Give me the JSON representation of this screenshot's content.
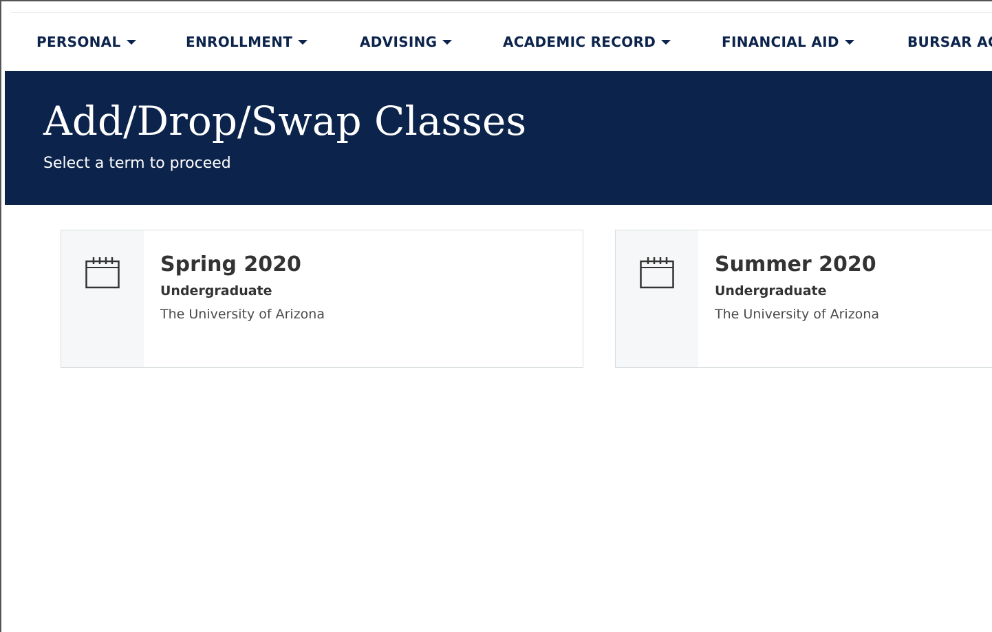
{
  "nav": {
    "items": [
      {
        "label": "PERSONAL",
        "icon": "caret-down-icon"
      },
      {
        "label": "ENROLLMENT",
        "icon": "caret-down-icon"
      },
      {
        "label": "ADVISING",
        "icon": "caret-down-icon"
      },
      {
        "label": "ACADEMIC RECORD",
        "icon": "caret-down-icon"
      },
      {
        "label": "FINANCIAL AID",
        "icon": "caret-down-icon"
      },
      {
        "label": "BURSAR ACCOUNT",
        "icon": "caret-down-icon"
      }
    ]
  },
  "header": {
    "title": "Add/Drop/Swap Classes",
    "subtitle": "Select a term to proceed"
  },
  "terms": [
    {
      "term": "Spring 2020",
      "career": "Undergraduate",
      "institution": "The University of Arizona",
      "icon": "calendar-icon"
    },
    {
      "term": "Summer 2020",
      "career": "Undergraduate",
      "institution": "The University of Arizona",
      "icon": "calendar-icon"
    }
  ],
  "colors": {
    "brand_navy": "#0c234b",
    "card_border": "#d8dde1",
    "icon_panel": "#f6f7f8",
    "text_dark": "#333333"
  }
}
